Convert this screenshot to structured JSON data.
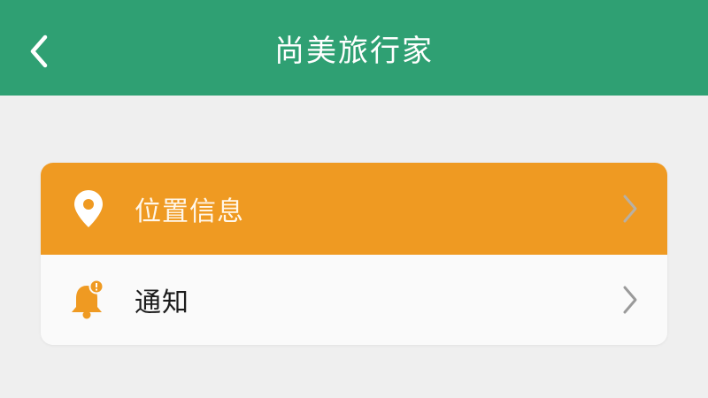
{
  "header": {
    "title": "尚美旅行家",
    "back_icon": "chevron-left-icon",
    "background": "#2fa073"
  },
  "menu": {
    "items": [
      {
        "label": "位置信息",
        "icon": "location-pin-icon",
        "highlighted": true,
        "background": "#ef9a22"
      },
      {
        "label": "通知",
        "icon": "notification-bell-icon",
        "highlighted": false,
        "background": "#fafafa"
      }
    ]
  },
  "colors": {
    "accent_green": "#2fa073",
    "accent_orange": "#ef9a22",
    "page_background": "#efefef"
  }
}
